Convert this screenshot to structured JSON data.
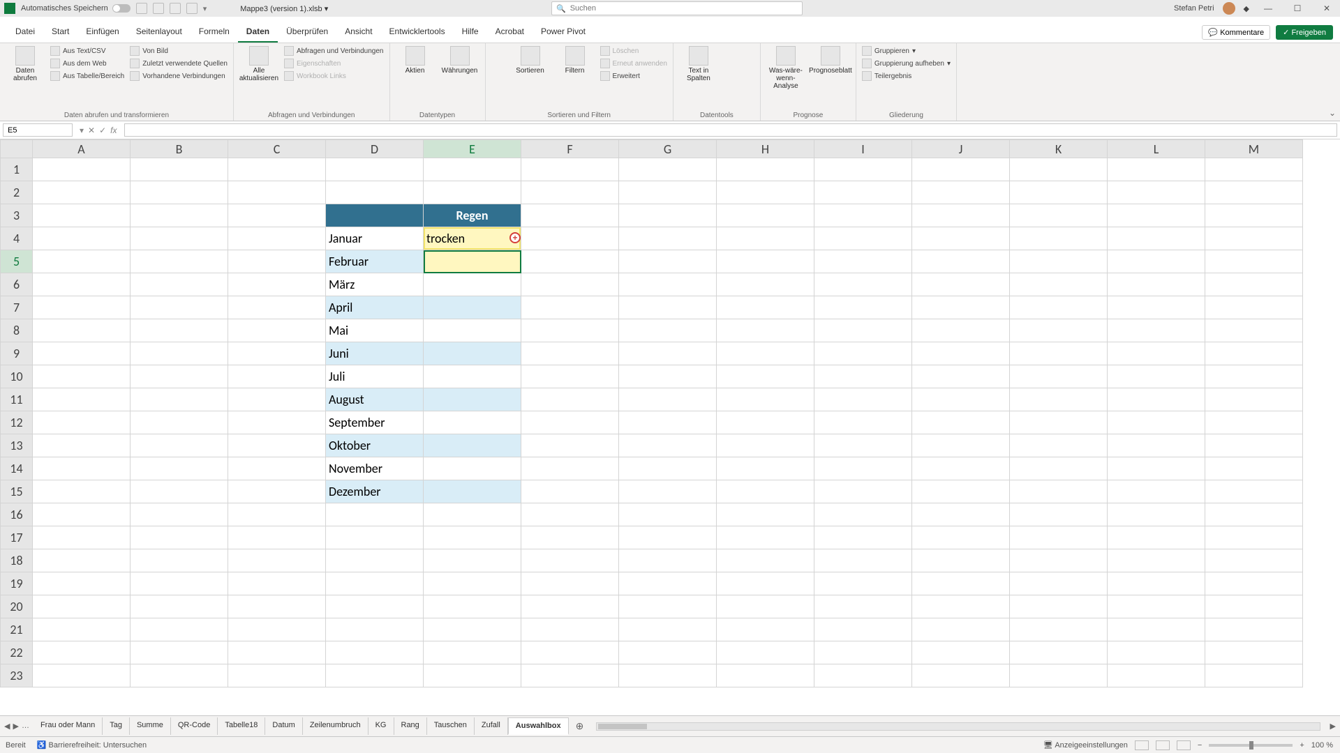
{
  "titlebar": {
    "autosave_label": "Automatisches Speichern",
    "filename": "Mappe3 (version 1).xlsb",
    "search_placeholder": "Suchen",
    "user_name": "Stefan Petri"
  },
  "tabs": {
    "items": [
      "Datei",
      "Start",
      "Einfügen",
      "Seitenlayout",
      "Formeln",
      "Daten",
      "Überprüfen",
      "Ansicht",
      "Entwicklertools",
      "Hilfe",
      "Acrobat",
      "Power Pivot"
    ],
    "active": "Daten",
    "kommentare": "Kommentare",
    "freigeben": "Freigeben"
  },
  "ribbon": {
    "g1": {
      "label": "Daten abrufen und transformieren",
      "big": "Daten abrufen",
      "items": [
        "Aus Text/CSV",
        "Aus dem Web",
        "Aus Tabelle/Bereich",
        "Von Bild",
        "Zuletzt verwendete Quellen",
        "Vorhandene Verbindungen"
      ]
    },
    "g2": {
      "label": "Abfragen und Verbindungen",
      "big": "Alle aktualisieren",
      "items": [
        "Abfragen und Verbindungen",
        "Eigenschaften",
        "Workbook Links"
      ]
    },
    "g3": {
      "label": "Datentypen",
      "btn1": "Aktien",
      "btn2": "Währungen"
    },
    "g4": {
      "label": "Sortieren und Filtern",
      "btn1": "Sortieren",
      "btn2": "Filtern",
      "items": [
        "Löschen",
        "Erneut anwenden",
        "Erweitert"
      ]
    },
    "g5": {
      "label": "Datentools",
      "big": "Text in Spalten"
    },
    "g6": {
      "label": "Prognose",
      "btn1": "Was-wäre-wenn-Analyse",
      "btn2": "Prognoseblatt"
    },
    "g7": {
      "label": "Gliederung",
      "items": [
        "Gruppieren",
        "Gruppierung aufheben",
        "Teilergebnis"
      ]
    }
  },
  "formula": {
    "namebox": "E5",
    "value": ""
  },
  "grid": {
    "columns": [
      "A",
      "B",
      "C",
      "D",
      "E",
      "F",
      "G",
      "H",
      "I",
      "J",
      "K",
      "L",
      "M"
    ],
    "active_col": "E",
    "active_row": 5,
    "selected_cell": "E5",
    "header_row": 3,
    "header_col": "E",
    "header_text": "Regen",
    "months_col": "D",
    "months_start_row": 4,
    "months": [
      "Januar",
      "Februar",
      "März",
      "April",
      "Mai",
      "Juni",
      "Juli",
      "August",
      "September",
      "Oktober",
      "November",
      "Dezember"
    ],
    "value_cell": {
      "row": 4,
      "col": "E",
      "text": "trocken"
    }
  },
  "sheets": {
    "items": [
      "Frau oder Mann",
      "Tag",
      "Summe",
      "QR-Code",
      "Tabelle18",
      "Datum",
      "Zeilenumbruch",
      "KG",
      "Rang",
      "Tauschen",
      "Zufall",
      "Auswahlbox"
    ],
    "active": "Auswahlbox"
  },
  "status": {
    "ready": "Bereit",
    "accessibility": "Barrierefreiheit: Untersuchen",
    "display_settings": "Anzeigeeinstellungen",
    "zoom": "100 %"
  }
}
